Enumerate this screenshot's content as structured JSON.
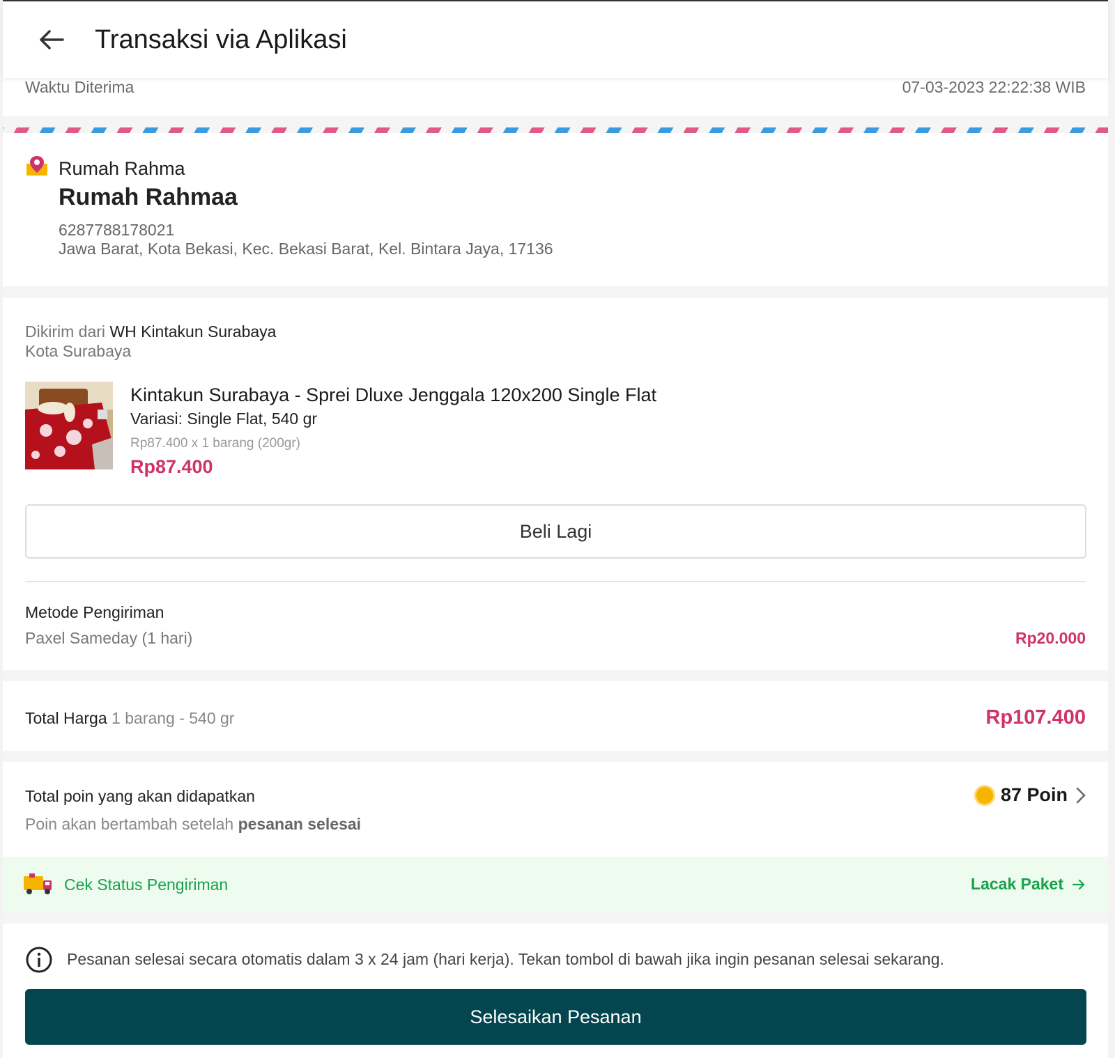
{
  "header": {
    "title": "Transaksi via Aplikasi"
  },
  "received": {
    "label": "Waktu Diterima",
    "value": "07-03-2023  22:22:38 WIB"
  },
  "address": {
    "label": "Rumah Rahma",
    "name": "Rumah Rahmaa",
    "phone": "6287788178021",
    "line": "Jawa Barat, Kota Bekasi, Kec. Bekasi Barat, Kel. Bintara Jaya, 17136"
  },
  "shipment": {
    "from_prefix": "Dikirim dari",
    "from_store": "WH Kintakun Surabaya",
    "from_city": "Kota Surabaya"
  },
  "product": {
    "name": "Kintakun Surabaya - Sprei Dluxe Jenggala 120x200 Single Flat",
    "variant": "Variasi: Single Flat, 540 gr",
    "calc": "Rp87.400 x 1 barang (200gr)",
    "price": "Rp87.400"
  },
  "buttons": {
    "buy_again": "Beli Lagi",
    "complete_order": "Selesaikan Pesanan"
  },
  "shipping": {
    "label": "Metode Pengiriman",
    "method": "Paxel Sameday (1 hari)",
    "price": "Rp20.000"
  },
  "total": {
    "label": "Total Harga",
    "detail": "1 barang - 540 gr",
    "price": "Rp107.400"
  },
  "points": {
    "label": "Total poin yang akan didapatkan",
    "sub_prefix": "Poin akan bertambah setelah",
    "sub_bold": "pesanan selesai",
    "value": "87 Poin"
  },
  "status": {
    "label": "Cek Status Pengiriman",
    "track": "Lacak Paket"
  },
  "info": {
    "text": "Pesanan selesai secara otomatis dalam 3 x 24 jam (hari kerja). Tekan tombol di bawah jika ingin pesanan selesai sekarang."
  },
  "colors": {
    "accent": "#d0336b",
    "primary_button": "#03464f",
    "success": "#17a34a"
  }
}
